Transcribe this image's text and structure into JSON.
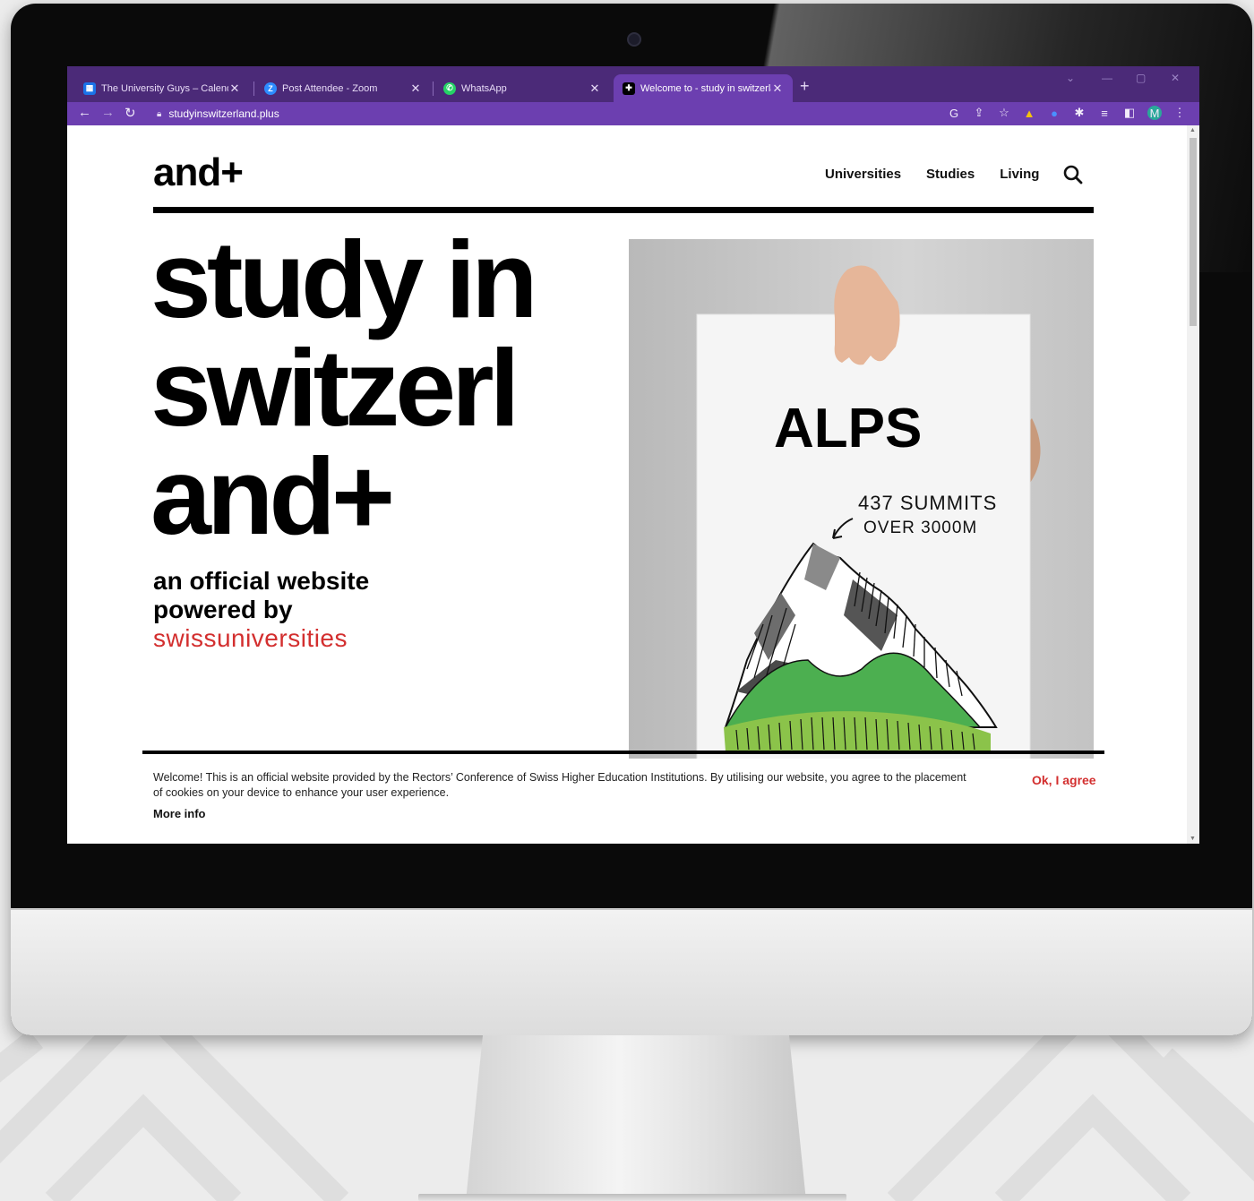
{
  "browser": {
    "tabs": [
      {
        "title": "The University Guys – Calendar -",
        "icon": "calendar-icon",
        "color": "#1a73e8"
      },
      {
        "title": "Post Attendee - Zoom",
        "icon": "zoom-icon",
        "color": "#2d8cff"
      },
      {
        "title": "WhatsApp",
        "icon": "whatsapp-icon",
        "color": "#25d366"
      },
      {
        "title": "Welcome to - study in switzerlan",
        "icon": "swiss-cross-icon",
        "color": "#000000"
      }
    ],
    "active_tab": 3,
    "url": "studyinswitzerland.plus",
    "profile_initial": "M"
  },
  "site": {
    "logo": "and+",
    "nav": [
      "Universities",
      "Studies",
      "Living"
    ],
    "hero_line1": "study in",
    "hero_line2": "switzerl",
    "hero_line3": "and+",
    "tagline_line1": "an official website",
    "tagline_line2": "powered by",
    "brand": "swissuniversities",
    "image": {
      "sign_title": "ALPS",
      "note_line1": "437 SUMMITS",
      "note_line2": "OVER 3000M"
    },
    "cookie": {
      "text": "Welcome! This is an official website provided by the Rectors’ Conference of Swiss Higher Education Institutions. By utilising our website, you agree to the placement of cookies on your device to enhance your user experience.",
      "more_info": "More info",
      "agree": "Ok, I agree"
    }
  },
  "colors": {
    "tabbar": "#4b2a78",
    "toolbar": "#6c3fb0",
    "accent_red": "#d32f2f"
  }
}
